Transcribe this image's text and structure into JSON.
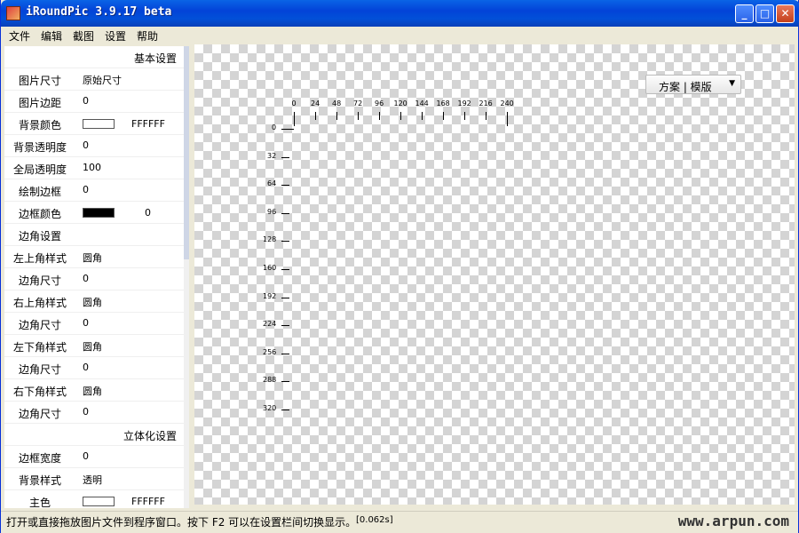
{
  "window": {
    "title": "iRoundPic 3.9.17 beta",
    "controls": [
      "_",
      "□",
      "✕"
    ]
  },
  "menu": [
    "文件",
    "编辑",
    "截图",
    "设置",
    "帮助"
  ],
  "properties": [
    {
      "type": "section",
      "label": "基本设置"
    },
    {
      "label": "图片尺寸",
      "value": "原始尺寸"
    },
    {
      "label": "图片边距",
      "value": "0"
    },
    {
      "label": "背景颜色",
      "swatch": "#FFFFFF",
      "value": "FFFFFF"
    },
    {
      "label": "背景透明度",
      "value": "0"
    },
    {
      "label": "全局透明度",
      "value": "100"
    },
    {
      "label": "绘制边框",
      "value": "0"
    },
    {
      "label": "边框颜色",
      "swatch": "#000000",
      "value": "0"
    },
    {
      "label": "边角设置",
      "value": ""
    },
    {
      "label": "左上角样式",
      "value": "圆角"
    },
    {
      "label": "边角尺寸",
      "value": "0"
    },
    {
      "label": "右上角样式",
      "value": "圆角"
    },
    {
      "label": "边角尺寸",
      "value": "0"
    },
    {
      "label": "左下角样式",
      "value": "圆角"
    },
    {
      "label": "边角尺寸",
      "value": "0"
    },
    {
      "label": "右下角样式",
      "value": "圆角"
    },
    {
      "label": "边角尺寸",
      "value": "0"
    },
    {
      "type": "section",
      "label": "立体化设置"
    },
    {
      "label": "边框宽度",
      "value": "0"
    },
    {
      "label": "背景样式",
      "value": "透明"
    },
    {
      "label": "主色",
      "swatch": "#FFFFFF",
      "value": "FFFFFF"
    }
  ],
  "ruler": {
    "x_ticks": [
      "0",
      "24",
      "48",
      "72",
      "96",
      "120",
      "144",
      "168",
      "192",
      "216",
      "240"
    ],
    "y_ticks": [
      "0",
      "32",
      "64",
      "96",
      "128",
      "160",
      "192",
      "224",
      "256",
      "288",
      "320"
    ]
  },
  "scheme_dropdown": {
    "label": "方案 | 模版"
  },
  "statusbar": {
    "message": "打开或直接拖放图片文件到程序窗口。按下 F2 可以在设置栏间切换显示。",
    "time": "[0.062s]"
  },
  "watermark": "www.arpun.com",
  "colors": {
    "titlebar": "#0a5ee0",
    "close_button": "#d2532a",
    "checker": "#d4d4d4"
  }
}
